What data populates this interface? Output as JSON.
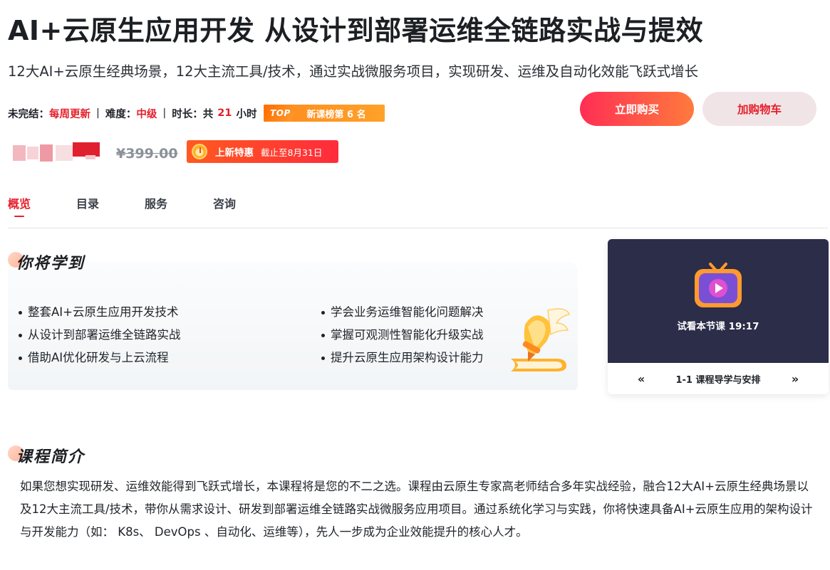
{
  "header": {
    "title": "AI+云原生应用开发 从设计到部署运维全链路实战与提效",
    "subtitle": "12大AI+云原生经典场景，12大主流工具/技术，通过实战微服务项目，实现研发、运维及自动化效能飞跃式增长"
  },
  "meta": {
    "status_label": "未完结：",
    "status_value": "每周更新",
    "level_label": "难度：",
    "level_value": "中级",
    "duration_label": "时长：",
    "duration_prefix": "共",
    "duration_value": "21",
    "duration_unit": "小时",
    "separator": "|",
    "rank_badge_top": "TOP",
    "rank_badge_text": "新课榜第 6 名"
  },
  "actions": {
    "buy_label": "立即购买",
    "cart_label": "加购物车"
  },
  "pricing": {
    "original_price": "¥399.00",
    "promo_label": "上新特惠",
    "promo_deadline": "截止至8月31日"
  },
  "tabs": [
    {
      "label": "概览"
    },
    {
      "label": "目录"
    },
    {
      "label": "服务"
    },
    {
      "label": "咨询"
    }
  ],
  "learn": {
    "title": "你将学到",
    "left_items": [
      "整套AI+云原生应用开发技术",
      "从设计到部署运维全链路实战",
      "借助AI优化研发与上云流程"
    ],
    "right_items": [
      "学会业务运维智能化问题解决",
      "掌握可观测性智能化升级实战",
      "提升云原生应用架构设计能力"
    ]
  },
  "video": {
    "caption": "试看本节课 19:17",
    "lesson_title": "1-1 课程导学与安排",
    "prev_symbol": "«",
    "next_symbol": "»"
  },
  "intro": {
    "title": "课程简介",
    "body": "如果您想实现研发、运维效能得到飞跃式增长，本课程将是您的不二之选。课程由云原生专家高老师结合多年实战经验，融合12大AI+云原生经典场景以及12大主流工具/技术，带你从需求设计、研发到部署运维全链路实战微服务应用项目。通过系统化学习与实践，你将快速具备AI+云原生应用的架构设计与开发能力（如： K8s、 DevOps 、自动化、运维等），先人一步成为企业效能提升的核心人才。"
  },
  "colors": {
    "accent_red": "#e5202b",
    "buy_gradient_start": "#ff2e54",
    "buy_gradient_end": "#ff7a3d",
    "promo_orange": "#ff5a1f",
    "rank_orange": "#ff8a1f",
    "video_bg": "#2b2d49"
  },
  "icons": {
    "promo": "alarm-clock-icon",
    "video": "tv-play-icon",
    "learn_illustration": "winged-pen-icon"
  }
}
